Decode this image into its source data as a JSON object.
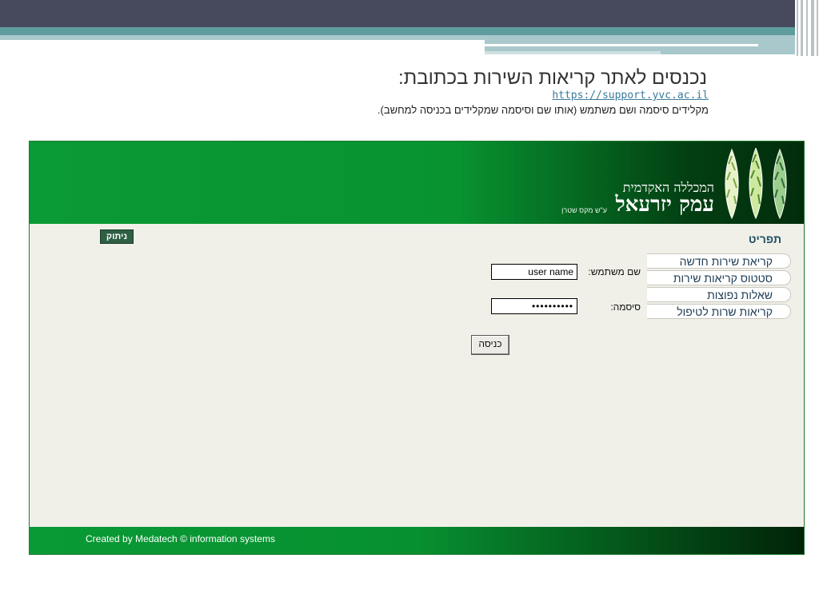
{
  "slide": {
    "title": "נכנסים לאתר קריאות השירות בכתובת:",
    "url": "https://support.yvc.ac.il",
    "description": "מקלידים סיסמה ושם משתמש (אותו שם וסיסמה שמקלידים בכניסה למחשב)."
  },
  "header": {
    "org_line1": "המכללה האקדמית",
    "org_line2": "עמק יזרעאל",
    "org_line3": "ע\"ש מקס שטרן"
  },
  "logout_label": "ניתוק",
  "menu": {
    "title": "תפריט",
    "items": [
      {
        "label": "קריאת שירות חדשה"
      },
      {
        "label": "סטטוס קריאות שירות"
      },
      {
        "label": "שאלות נפוצות"
      },
      {
        "label": "קריאות שרות לטיפול"
      }
    ]
  },
  "login": {
    "username_label": "שם משתמש:",
    "username_value": "user name",
    "password_label": "סיסמה:",
    "password_value": "••••••••••",
    "submit_label": "כניסה"
  },
  "footer": {
    "credit": "Created by Medatech © information systems"
  },
  "colors": {
    "header_green": "#0a9a36",
    "menu_title": "#1f4f66",
    "slide_dark": "#474a5c",
    "slide_teal": "#5e9c9e"
  }
}
